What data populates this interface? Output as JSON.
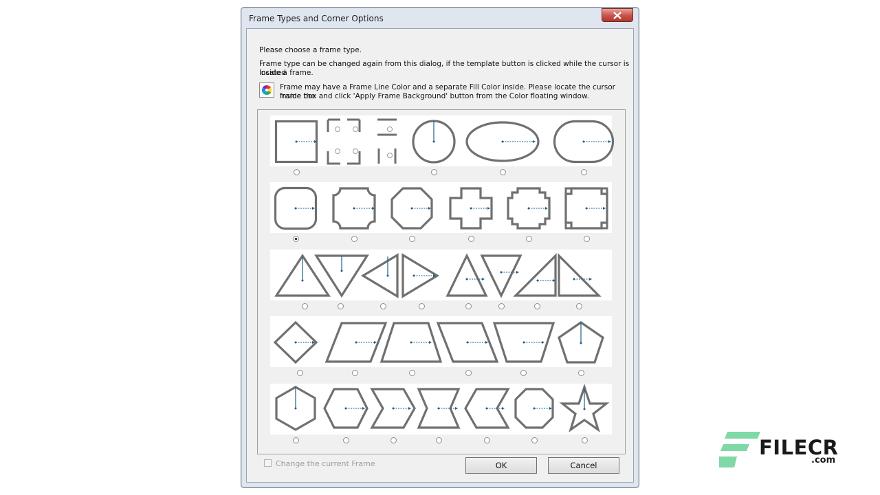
{
  "dialog": {
    "title": "Frame Types and Corner Options",
    "line1": "Please choose a frame type.",
    "line2a": "Frame type can be changed again from this dialog, if the template button is clicked while the cursor is located",
    "line2b": "inside a frame.",
    "line3a": "Frame may have a Frame Line Color and a separate Fill Color inside. Please locate the cursor inside the",
    "line3b": "frame box and click 'Apply Frame Background' button from the Color floating window.",
    "checkbox_label": "Change the current Frame",
    "checkbox_checked": false,
    "ok_label": "OK",
    "cancel_label": "Cancel",
    "selected_frame": "rounded-square"
  },
  "frame_rows": [
    [
      "square",
      "corner-options",
      "circle",
      "ellipse",
      "rounded-rectangle"
    ],
    [
      "rounded-square",
      "scalloped",
      "octagon",
      "cross",
      "stepped",
      "notched"
    ],
    [
      "triangle-up",
      "triangle-down",
      "triangle-left",
      "triangle-right",
      "triangle-up-small",
      "triangle-down-small",
      "right-triangle-left",
      "right-triangle-right"
    ],
    [
      "diamond",
      "parallelogram",
      "trapezoid",
      "parallelogram-reverse",
      "trapezoid-inverted",
      "pentagon"
    ],
    [
      "hexagon",
      "hexagon-wide",
      "chevron",
      "hourglass",
      "chevron-reverse",
      "octagon-small",
      "star"
    ]
  ],
  "colors": {
    "shape_stroke": "#707070",
    "pointer": "#1f5f86",
    "close_button": "#c75050",
    "logo_green": "#7ed9a6"
  },
  "watermark": {
    "brand": "FILECR",
    "suffix": ".com"
  }
}
